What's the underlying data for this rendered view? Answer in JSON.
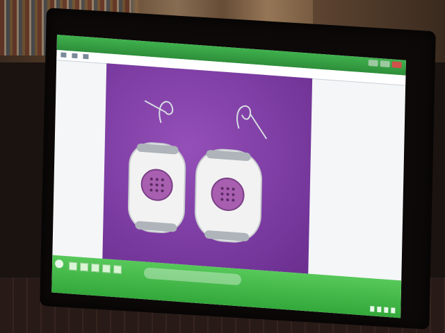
{
  "scene": {
    "colors": {
      "photo_background": "#7d3da3",
      "taskbar": "#33a83a",
      "screen": "#f4f6f7",
      "bead_white": "#f2f2f2",
      "bead_grey": "#aeb4ba",
      "bead_center": "#a85fb0"
    }
  },
  "icons": [
    "start-orb-icon",
    "taskbar-app-icon",
    "media-player-icon",
    "tray-icon",
    "close-icon",
    "maximize-icon",
    "minimize-icon"
  ]
}
